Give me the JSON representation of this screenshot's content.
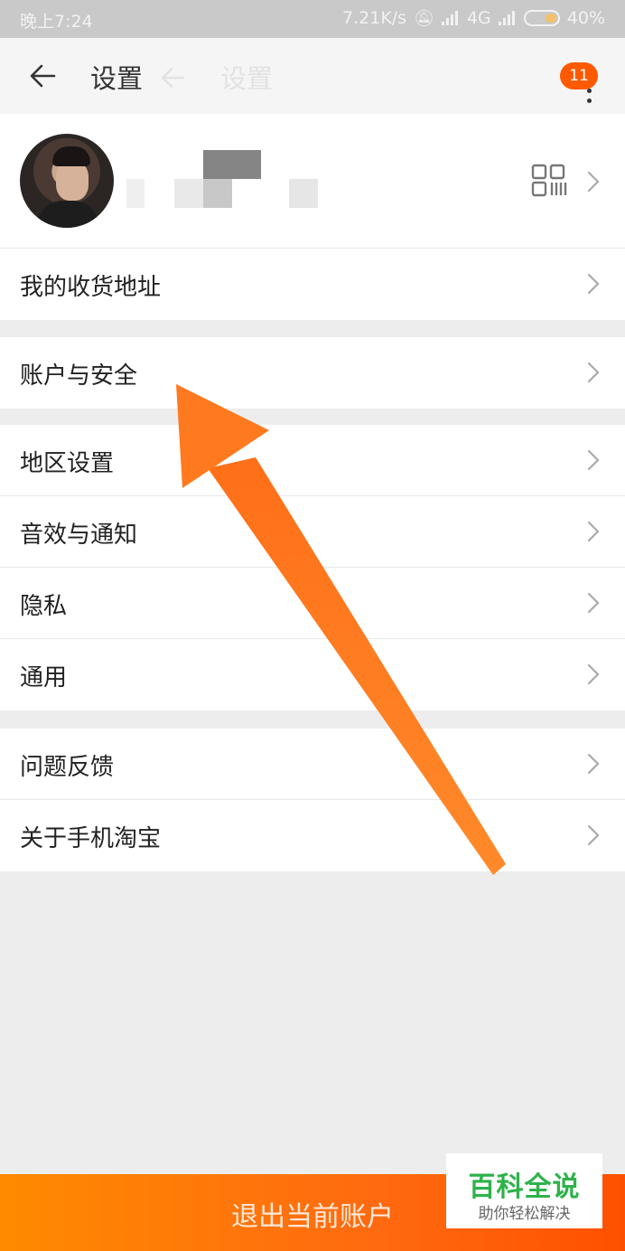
{
  "status_bar": {
    "time": "晚上7:24",
    "speed": "7.21K/s",
    "network": "4G",
    "battery": "40%"
  },
  "header": {
    "title": "设置",
    "ghost_title": "设置",
    "badge": "11",
    "icons": {
      "back": "back-arrow-icon",
      "more": "more-vertical-icon"
    }
  },
  "profile": {
    "icons": {
      "qr": "qr-code-icon",
      "chevron": "chevron-right-icon"
    }
  },
  "groups": [
    {
      "items": [
        {
          "label": "我的收货地址"
        }
      ]
    },
    {
      "items": [
        {
          "label": "账户与安全"
        }
      ]
    },
    {
      "items": [
        {
          "label": "地区设置"
        },
        {
          "label": "音效与通知"
        },
        {
          "label": "隐私"
        },
        {
          "label": "通用"
        }
      ]
    },
    {
      "items": [
        {
          "label": "问题反馈"
        },
        {
          "label": "关于手机淘宝"
        }
      ]
    }
  ],
  "logout": {
    "label": "退出当前账户"
  },
  "watermark": {
    "title": "百科全说",
    "subtitle": "助你轻松解决"
  },
  "colors": {
    "accent": "#ff5a00",
    "arrow": "#ff7a1e",
    "watermark_green": "#2db24a"
  }
}
